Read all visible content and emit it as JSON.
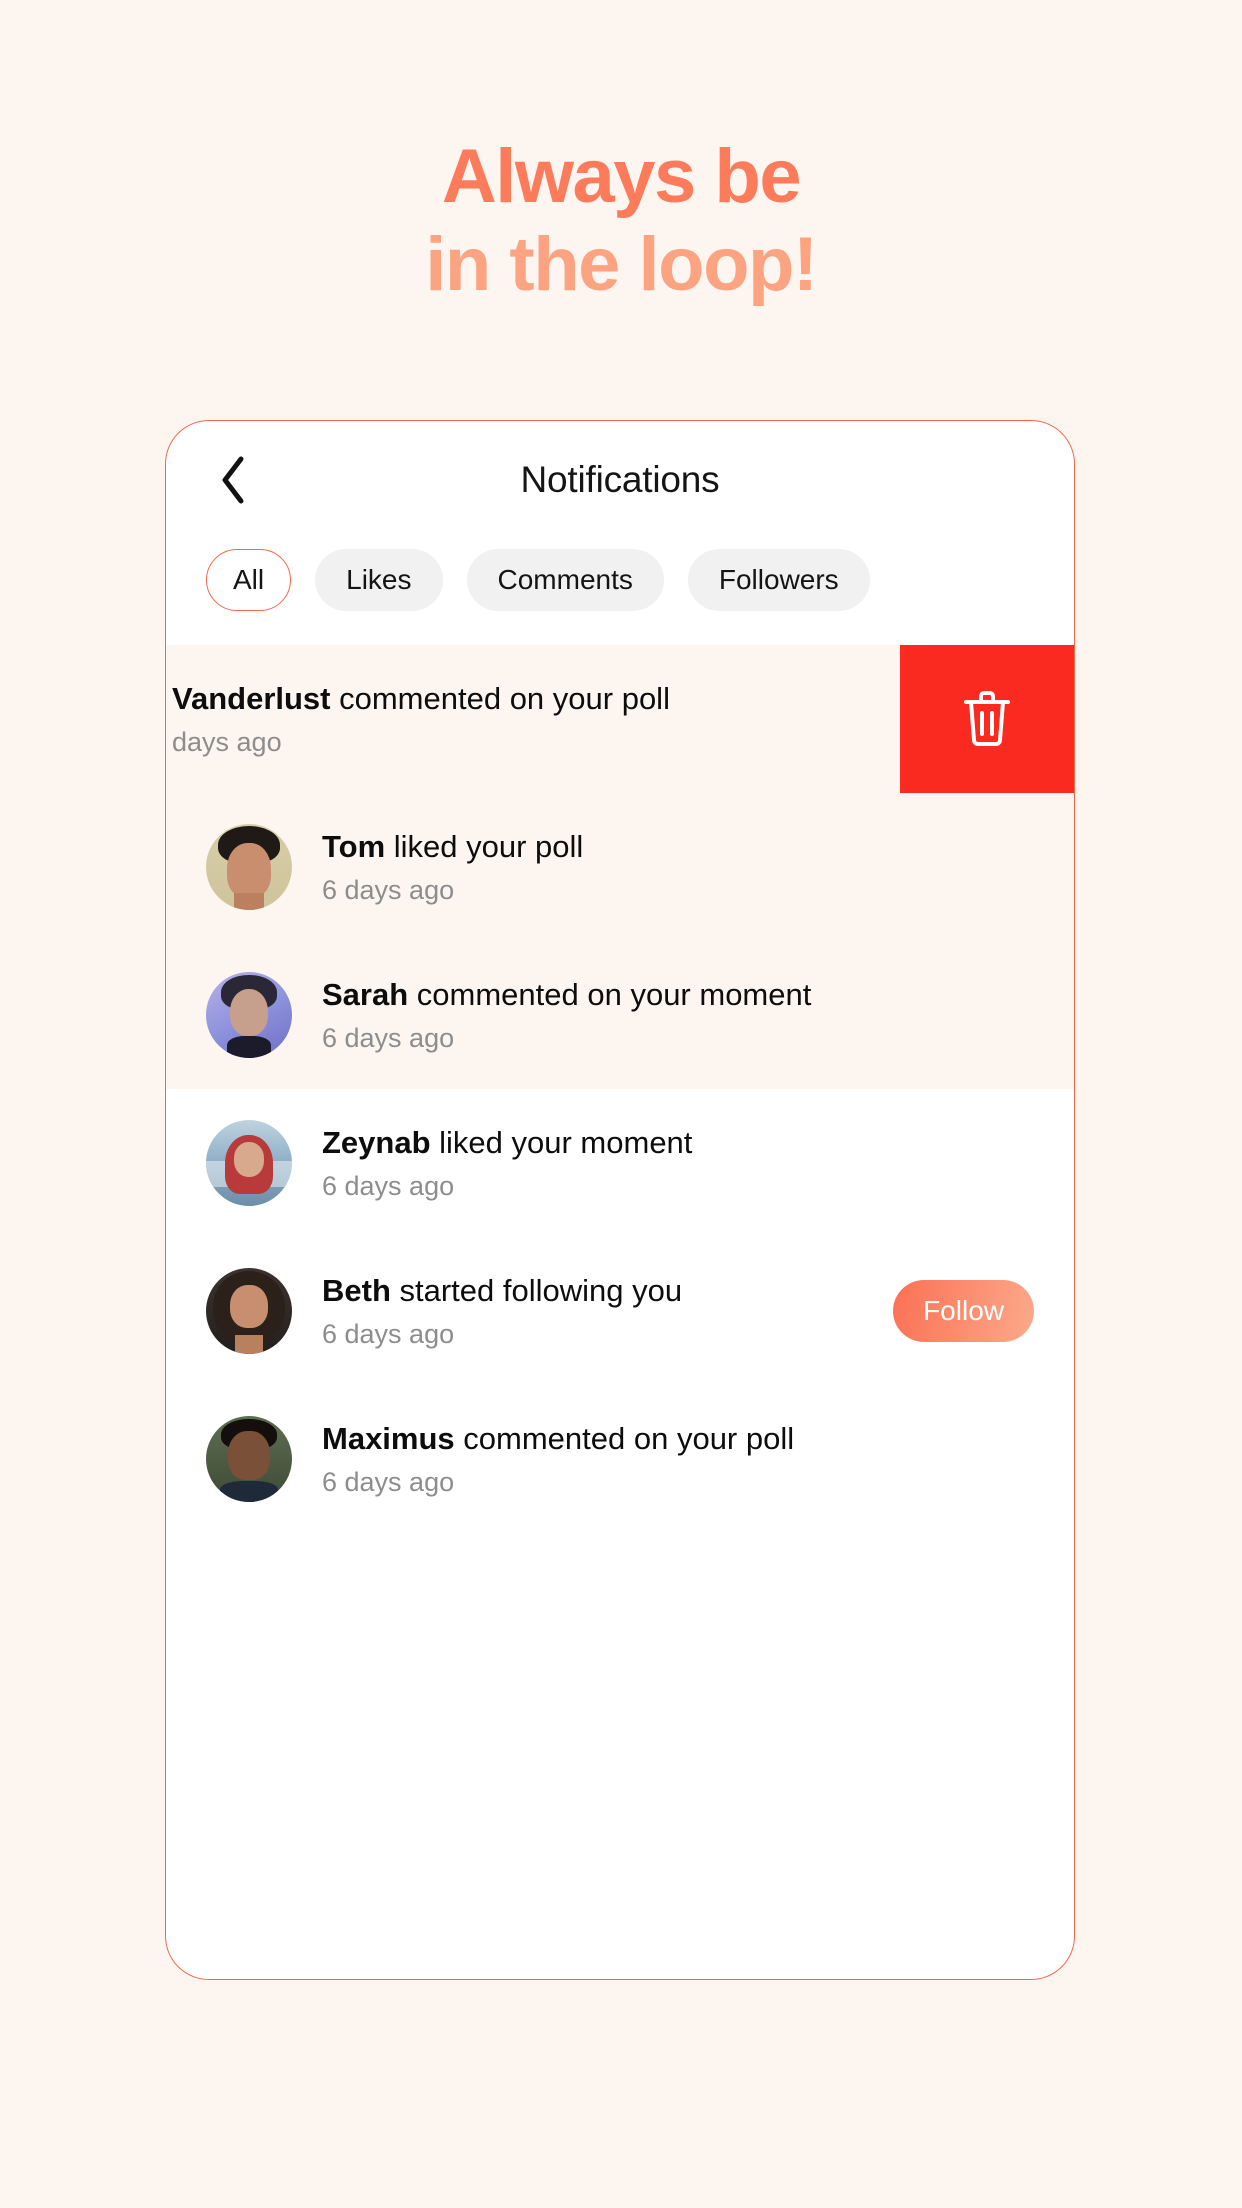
{
  "promo": {
    "headline_line1": "Always be",
    "headline_line2": "in the loop!",
    "color_primary": "#FB7B5B",
    "color_secondary": "#FCA382",
    "background": "#FDF5EF"
  },
  "app": {
    "title": "Notifications",
    "back_icon": "chevron-left-icon",
    "frame_border_color": "#F4674A"
  },
  "tabs": {
    "items": [
      {
        "label": "All",
        "active": true
      },
      {
        "label": "Likes",
        "active": false
      },
      {
        "label": "Comments",
        "active": false
      },
      {
        "label": "Followers",
        "active": false
      }
    ],
    "active_border_color": "#F4674A",
    "inactive_background": "#F1F1F1"
  },
  "swipe_action": {
    "icon": "trash-icon",
    "background": "#FA2A21"
  },
  "notifications": [
    {
      "name": "Vanderlust",
      "action": " commented on your poll",
      "time": "days ago",
      "avatar": "av-vanderlust",
      "unread": true,
      "swiped": true,
      "has_follow": false
    },
    {
      "name": "Tom",
      "action": " liked your poll",
      "time": "6 days ago",
      "avatar": "av-tom",
      "unread": true,
      "swiped": false,
      "has_follow": false
    },
    {
      "name": "Sarah",
      "action": " commented on your moment",
      "time": "6 days ago",
      "avatar": "av-sarah",
      "unread": true,
      "swiped": false,
      "has_follow": false
    },
    {
      "name": "Zeynab",
      "action": " liked your moment",
      "time": "6 days ago",
      "avatar": "av-zeynab",
      "unread": false,
      "swiped": false,
      "has_follow": false
    },
    {
      "name": "Beth",
      "action": " started following you",
      "time": "6 days ago",
      "avatar": "av-beth",
      "unread": false,
      "swiped": false,
      "has_follow": true,
      "follow_label": "Follow"
    },
    {
      "name": "Maximus",
      "action": " commented on your poll",
      "time": "6 days ago",
      "avatar": "av-maximus",
      "unread": false,
      "swiped": false,
      "has_follow": false
    }
  ]
}
